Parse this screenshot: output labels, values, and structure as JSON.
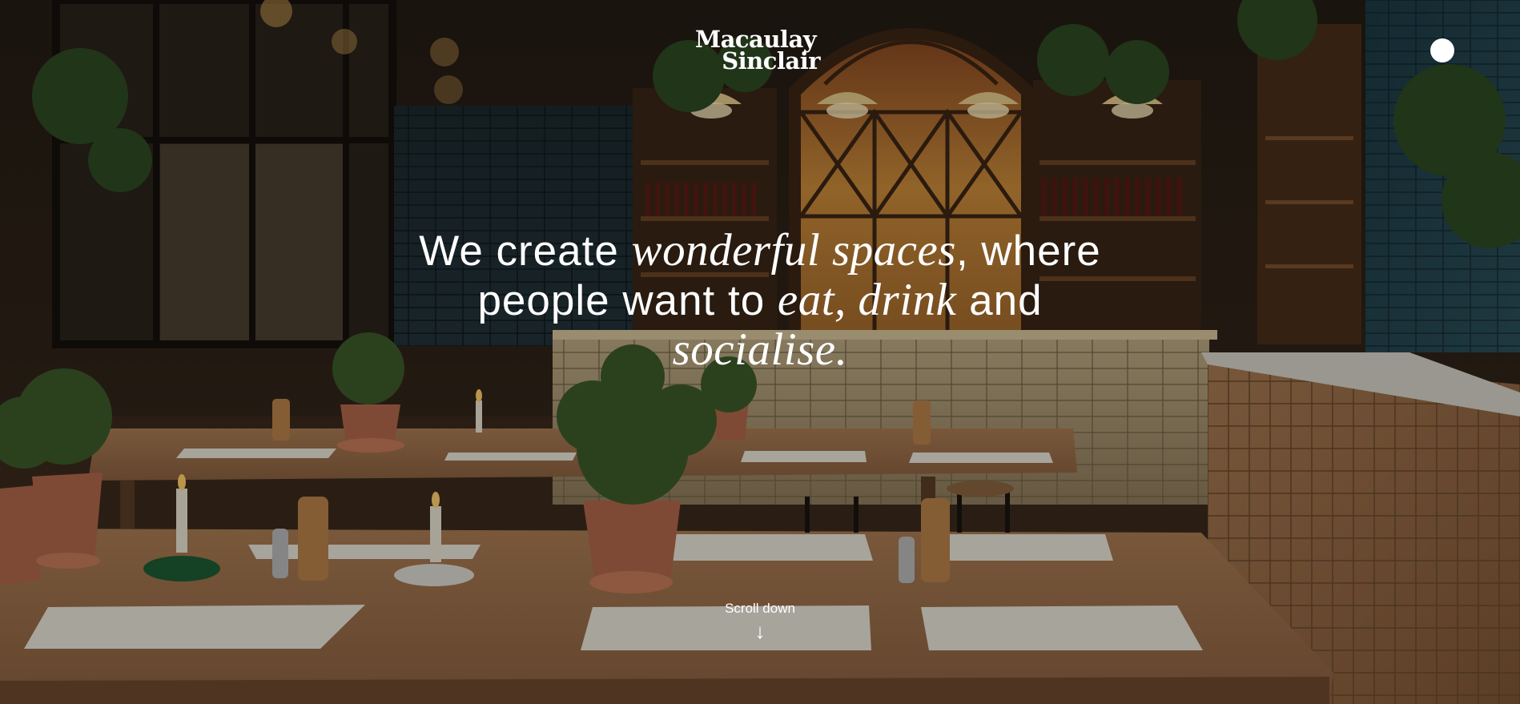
{
  "brand": {
    "line1": "Macaulay",
    "line2": "Sinclair"
  },
  "headline": {
    "part1": "We create ",
    "em1": "wonderful spaces",
    "part2": ", where people want to ",
    "em2": "eat, drink",
    "part3": " and ",
    "em3": "socialise."
  },
  "scroll": {
    "label": "Scroll down",
    "arrow": "↓"
  },
  "colors": {
    "text": "#ffffff",
    "overlay": "rgba(0,0,0,0.28)"
  },
  "icons": {
    "menu": "menu-dot-icon",
    "scroll": "arrow-down-icon"
  }
}
